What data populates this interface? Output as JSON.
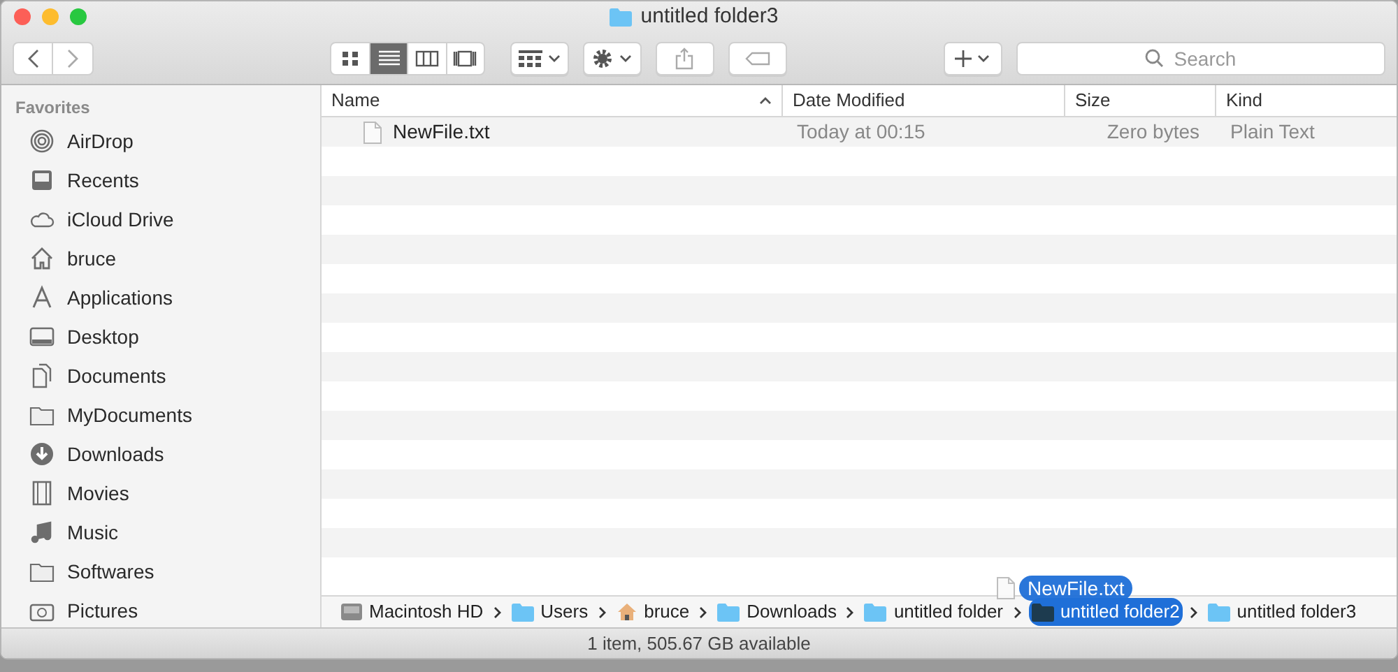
{
  "window": {
    "title": "untitled folder3"
  },
  "toolbar": {
    "view_modes": [
      {
        "selected": false
      },
      {
        "selected": true
      },
      {
        "selected": false
      },
      {
        "selected": false
      }
    ],
    "search": {
      "placeholder": "Search"
    }
  },
  "sidebar": {
    "heading": "Favorites",
    "items": [
      {
        "label": "AirDrop"
      },
      {
        "label": "Recents"
      },
      {
        "label": "iCloud Drive"
      },
      {
        "label": "bruce"
      },
      {
        "label": "Applications"
      },
      {
        "label": "Desktop"
      },
      {
        "label": "Documents"
      },
      {
        "label": "MyDocuments"
      },
      {
        "label": "Downloads"
      },
      {
        "label": "Movies"
      },
      {
        "label": "Music"
      },
      {
        "label": "Softwares"
      },
      {
        "label": "Pictures"
      }
    ]
  },
  "table": {
    "columns": [
      "Name",
      "Date Modified",
      "Size",
      "Kind"
    ],
    "rows": [
      {
        "name": "NewFile.txt",
        "date_modified": "Today at 00:15",
        "size": "Zero bytes",
        "kind": "Plain Text"
      }
    ]
  },
  "path_bar": [
    {
      "label": "Macintosh HD",
      "selected": false
    },
    {
      "label": "Users",
      "selected": false
    },
    {
      "label": "bruce",
      "selected": false
    },
    {
      "label": "Downloads",
      "selected": false
    },
    {
      "label": "untitled folder",
      "selected": false
    },
    {
      "label": "untitled folder2",
      "selected": true
    },
    {
      "label": "untitled folder3",
      "selected": false
    }
  ],
  "drag_item": {
    "label": "NewFile.txt"
  },
  "status_bar": "1 item, 505.67 GB available"
}
